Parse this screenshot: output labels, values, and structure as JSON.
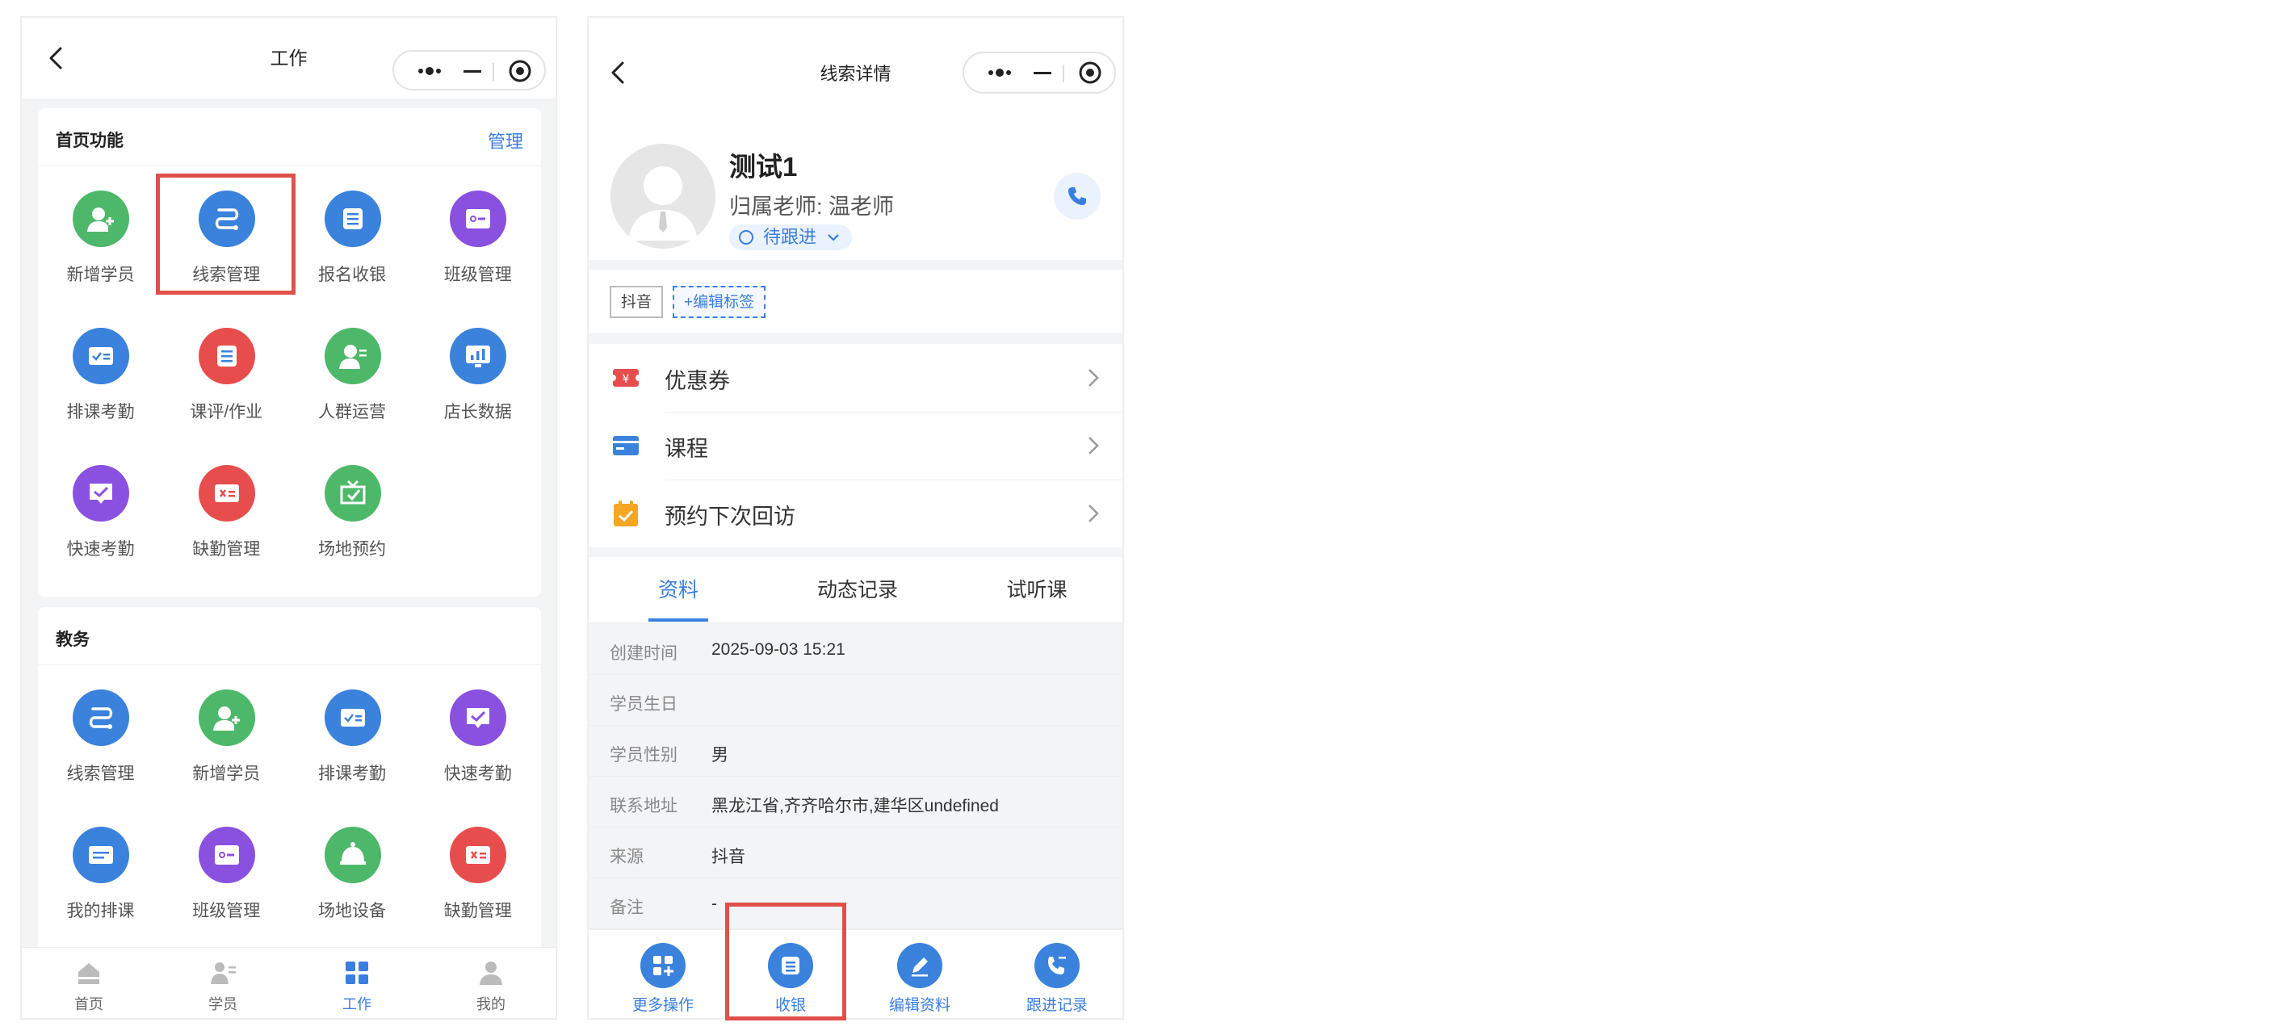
{
  "left": {
    "nav_title": "工作",
    "card1": {
      "title": "首页功能",
      "manage": "管理",
      "items": [
        {
          "label": "新增学员",
          "icon": "add-user-icon",
          "color": "#4db86a"
        },
        {
          "label": "线索管理",
          "icon": "route-icon",
          "color": "#3a82dc"
        },
        {
          "label": "报名收银",
          "icon": "list-icon",
          "color": "#3a82dc"
        },
        {
          "label": "班级管理",
          "icon": "class-card-icon",
          "color": "#8a50e0"
        },
        {
          "label": "排课考勤",
          "icon": "schedule-check-icon",
          "color": "#3a82dc"
        },
        {
          "label": "课评/作业",
          "icon": "list-icon",
          "color": "#e84d4d"
        },
        {
          "label": "人群运营",
          "icon": "people-icon",
          "color": "#4db86a"
        },
        {
          "label": "店长数据",
          "icon": "chart-icon",
          "color": "#3a82dc"
        },
        {
          "label": "快速考勤",
          "icon": "quick-check-icon",
          "color": "#8a50e0"
        },
        {
          "label": "缺勤管理",
          "icon": "absence-icon",
          "color": "#e84d4d"
        },
        {
          "label": "场地预约",
          "icon": "venue-icon",
          "color": "#4db86a"
        }
      ]
    },
    "card2": {
      "title": "教务",
      "items": [
        {
          "label": "线索管理",
          "icon": "route-icon",
          "color": "#3a82dc"
        },
        {
          "label": "新增学员",
          "icon": "add-user-icon",
          "color": "#4db86a"
        },
        {
          "label": "排课考勤",
          "icon": "schedule-check-icon",
          "color": "#3a82dc"
        },
        {
          "label": "快速考勤",
          "icon": "quick-check-icon",
          "color": "#8a50e0"
        },
        {
          "label": "我的排课",
          "icon": "my-schedule-icon",
          "color": "#3a82dc"
        },
        {
          "label": "班级管理",
          "icon": "class-card-icon",
          "color": "#8a50e0"
        },
        {
          "label": "场地设备",
          "icon": "bell-icon",
          "color": "#4db86a"
        },
        {
          "label": "缺勤管理",
          "icon": "absence-icon",
          "color": "#e84d4d"
        }
      ]
    },
    "tabbar": [
      {
        "label": "首页",
        "icon": "home-icon"
      },
      {
        "label": "学员",
        "icon": "student-icon"
      },
      {
        "label": "工作",
        "icon": "work-grid-icon",
        "active": true
      },
      {
        "label": "我的",
        "icon": "profile-icon"
      }
    ],
    "accent": "#3a7ee0",
    "highlight": "#e0504a"
  },
  "right": {
    "nav_title": "线索详情",
    "profile": {
      "name": "测试1",
      "teacher": "归属老师: 温老师",
      "status": "待跟进"
    },
    "tags": [
      "抖音",
      "+编辑标签"
    ],
    "menu": [
      {
        "label": "优惠券",
        "icon": "coupon-icon"
      },
      {
        "label": "课程",
        "icon": "course-icon"
      },
      {
        "label": "预约下次回访",
        "icon": "calendar-check-icon"
      }
    ],
    "tabs": [
      "资料",
      "动态记录",
      "试听课"
    ],
    "info": [
      {
        "key": "创建时间",
        "value": "2025-09-03 15:21"
      },
      {
        "key": "学员生日",
        "value": ""
      },
      {
        "key": "学员性别",
        "value": "男"
      },
      {
        "key": "联系地址",
        "value": "黑龙江省,齐齐哈尔市,建华区undefined"
      },
      {
        "key": "来源",
        "value": "抖音"
      },
      {
        "key": "备注",
        "value": "-"
      }
    ],
    "actions": [
      {
        "label": "更多操作",
        "icon": "more-grid-icon"
      },
      {
        "label": "收银",
        "icon": "cashier-icon"
      },
      {
        "label": "编辑资料",
        "icon": "edit-icon"
      },
      {
        "label": "跟进记录",
        "icon": "follow-phone-icon"
      }
    ]
  }
}
